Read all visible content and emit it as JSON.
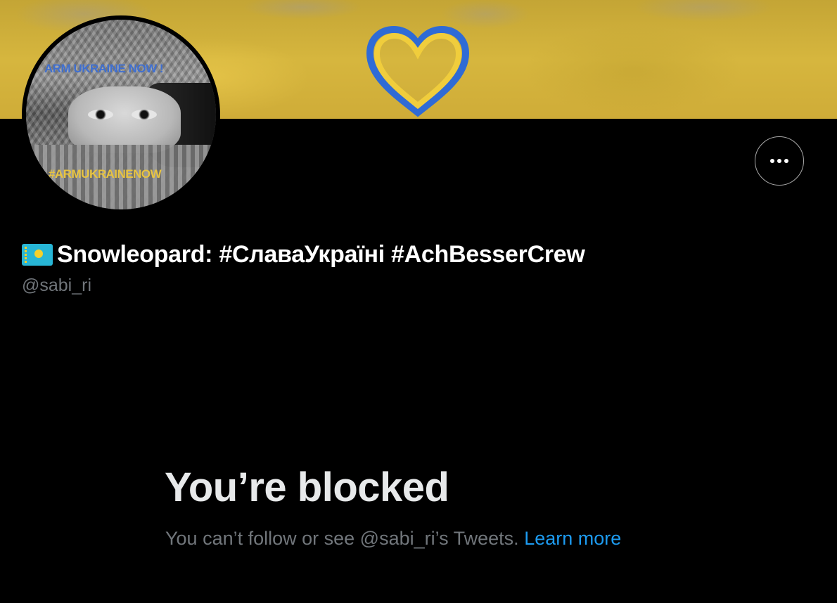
{
  "banner": {
    "colors": {
      "yellow": "#d4b43d",
      "heart_blue": "#2f6bd5",
      "heart_yellow": "#f0cd3c"
    },
    "heart_icon": "ukraine-heart-icon"
  },
  "avatar": {
    "top_text": "ARM UKRAINE NOW !",
    "bottom_text": "#ARMUKRAINENOW"
  },
  "more_button": {
    "icon": "more-horizontal-icon"
  },
  "profile": {
    "flag_icon": "kazakhstan-flag-icon",
    "display_name": "Snowleopard: #СлаваУкраїні #AchBesserCrew",
    "handle": "@sabi_ri"
  },
  "blocked": {
    "title": "You’re blocked",
    "description": "You can’t follow or see @sabi_ri’s Tweets.",
    "link_label": "Learn more"
  },
  "colors": {
    "background": "#000000",
    "text": "#e7e9ea",
    "secondary": "#71767b",
    "link": "#1d9bf0"
  }
}
